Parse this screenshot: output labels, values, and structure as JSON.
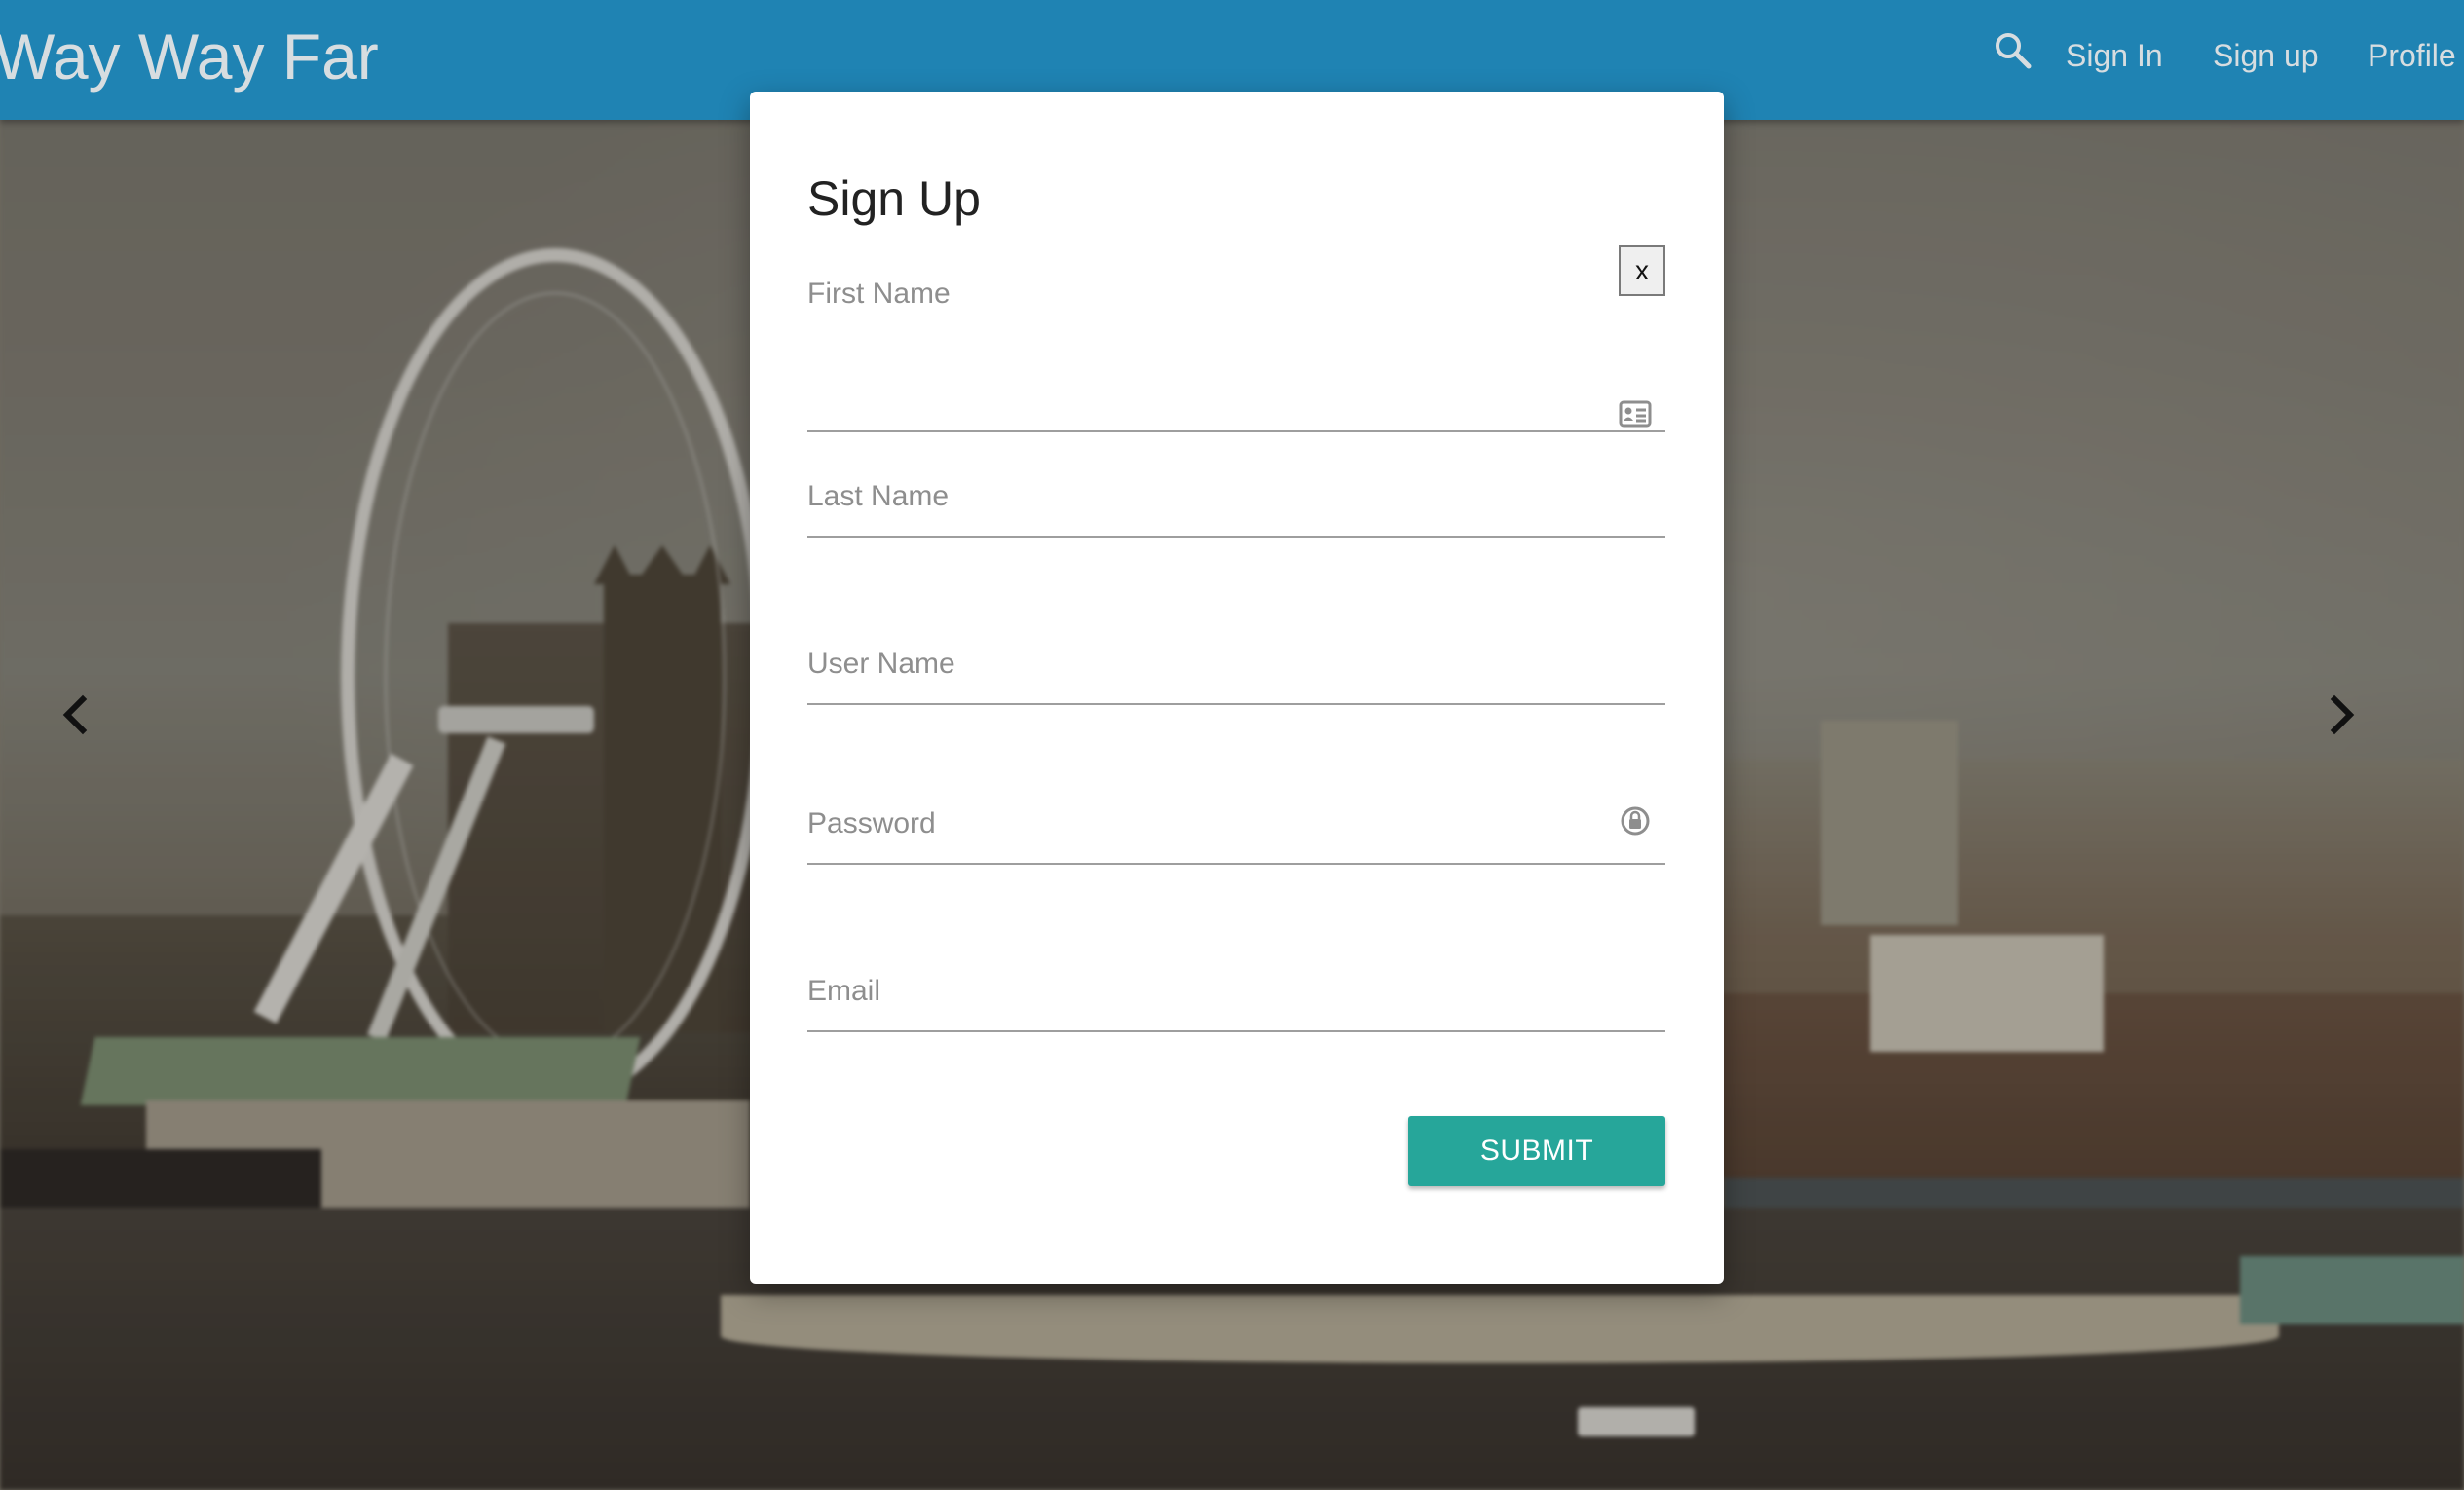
{
  "navbar": {
    "brand": "Way Way Far",
    "search_icon": "search-icon",
    "links": [
      {
        "label": "Sign In"
      },
      {
        "label": "Sign up"
      },
      {
        "label": "Profile"
      }
    ],
    "background_color": "#1f83b3",
    "text_color": "#d7dde0"
  },
  "carousel": {
    "prev_icon": "chevron-left-icon",
    "next_icon": "chevron-right-icon"
  },
  "modal": {
    "title": "Sign Up",
    "close_label": "x",
    "fields": {
      "first_name": {
        "label": "First Name",
        "value": "",
        "icon": "id-card-icon"
      },
      "last_name": {
        "label": "Last Name",
        "value": ""
      },
      "user_name": {
        "label": "User Name",
        "value": ""
      },
      "password": {
        "label": "Password",
        "value": "",
        "icon": "lock-icon"
      },
      "email": {
        "label": "Email",
        "value": ""
      }
    },
    "submit_label": "SUBMIT",
    "submit_color": "#26a69a"
  }
}
